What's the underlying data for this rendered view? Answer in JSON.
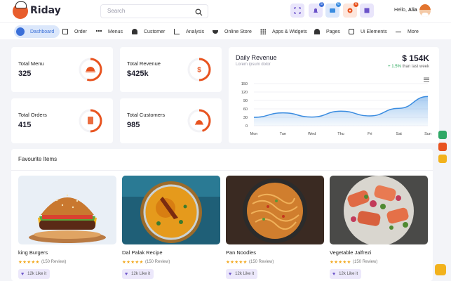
{
  "brand": "Riday",
  "search": {
    "placeholder": "Search"
  },
  "user": {
    "greeting": "Hello,",
    "name": "Alia"
  },
  "header_badges": [
    "5",
    "6",
    "6"
  ],
  "nav": [
    "Dashboard",
    "Order",
    "Menus",
    "Customer",
    "Analysis",
    "Online Store",
    "Apps & Widgets",
    "Pages",
    "Ui Elements",
    "More"
  ],
  "stats": [
    {
      "label": "Total Menu",
      "value": "325",
      "progress": 0.55
    },
    {
      "label": "Total Revenue",
      "value": "$425k",
      "progress": 0.5
    },
    {
      "label": "Total Orders",
      "value": "415",
      "progress": 0.5
    },
    {
      "label": "Total Customers",
      "value": "985",
      "progress": 0.45
    }
  ],
  "revenue": {
    "title": "Daily Revenue",
    "subtitle": "Lorem ipsum dolor",
    "amount": "$ 154K",
    "change": "+ 1.5%",
    "change_suffix": " than last week"
  },
  "chart_data": {
    "type": "area",
    "categories": [
      "Mon",
      "Tue",
      "Wed",
      "Thu",
      "Fri",
      "Sat",
      "Sun"
    ],
    "values": [
      30,
      46,
      31,
      52,
      35,
      62,
      104
    ],
    "ylim": [
      0,
      150
    ],
    "yticks": [
      "0",
      "30",
      "60",
      "90",
      "120",
      "150"
    ],
    "grid": true
  },
  "favourites": {
    "title": "Favourite Items",
    "items": [
      {
        "name": "king Burgers",
        "reviews": "(150 Review)",
        "likes": "12k Like it"
      },
      {
        "name": "Dal Palak Recipe",
        "reviews": "(150 Review)",
        "likes": "12k Like it"
      },
      {
        "name": "Pan Noodles",
        "reviews": "(150 Review)",
        "likes": "12k Like it"
      },
      {
        "name": "Vegetable Jalfrezi",
        "reviews": "(150 Review)",
        "likes": "12k Like it"
      }
    ],
    "rating": 5
  },
  "colors": {
    "accent": "#e8531f",
    "primary": "#3a6fd8",
    "like_bg": "#ece8fb"
  }
}
